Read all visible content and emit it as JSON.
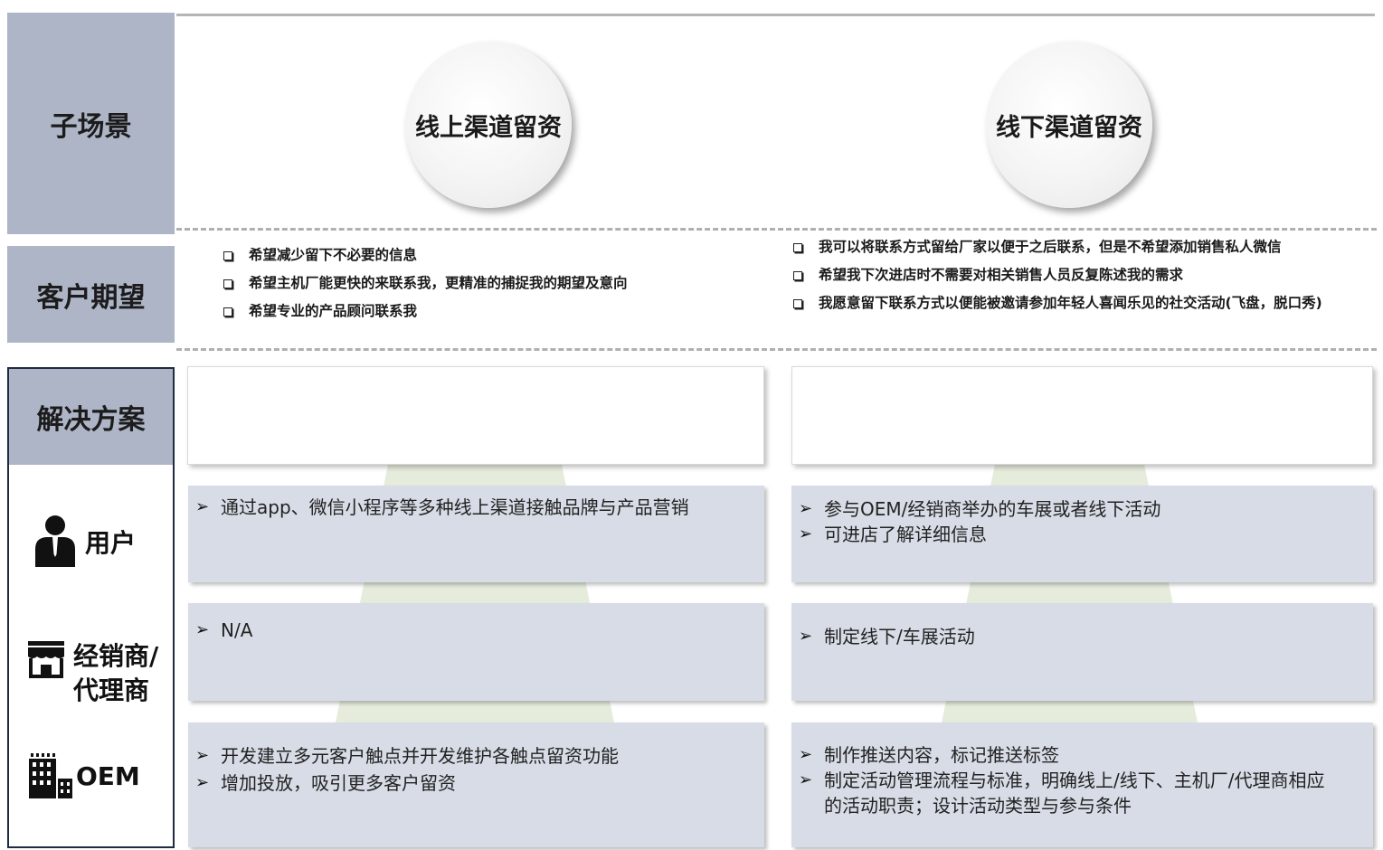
{
  "rows": {
    "sub_scene": "子场景",
    "expectation": "客户期望",
    "solution": "解决方案"
  },
  "roles": {
    "user": "用户",
    "dealer_line1": "经销商/",
    "dealer_line2": "代理商",
    "oem": "OEM"
  },
  "scenes": {
    "online": "线上渠道留资",
    "offline": "线下渠道留资"
  },
  "expectations": {
    "online": [
      "希望减少留下不必要的信息",
      "希望主机厂能更快的来联系我，更精准的捕捉我的期望及意向",
      "希望专业的产品顾问联系我"
    ],
    "offline": [
      "我可以将联系方式留给厂家以便于之后联系，但是不希望添加销售私人微信",
      "希望我下次进店时不需要对相关销售人员反复陈述我的需求",
      "我愿意留下联系方式以便能被邀请参加年轻人喜闻乐见的社交活动(飞盘，脱口秀)"
    ]
  },
  "solutions": {
    "online": {
      "user": [
        "通过app、微信小程序等多种线上渠道接触品牌与产品营销"
      ],
      "dealer": [
        "N/A"
      ],
      "oem": [
        "开发建立多元客户触点并开发维护各触点留资功能",
        "增加投放，吸引更多客户留资"
      ]
    },
    "offline": {
      "user": [
        "参与OEM/经销商举办的车展或者线下活动",
        "可进店了解详细信息"
      ],
      "dealer": [
        "制定线下/车展活动"
      ],
      "oem": [
        "制作推送内容，标记推送标签",
        "制定活动管理流程与标准，明确线上/线下、主机厂/代理商相应的活动职责；设计活动类型与参与条件"
      ]
    }
  },
  "icons": [
    "user-icon",
    "store-icon",
    "building-icon"
  ],
  "colors": {
    "label_bg": "#aeb5c7",
    "box_bg": "#d7dce6",
    "trapezoid": "#e6ecdc",
    "column_border": "#1f2a44"
  }
}
